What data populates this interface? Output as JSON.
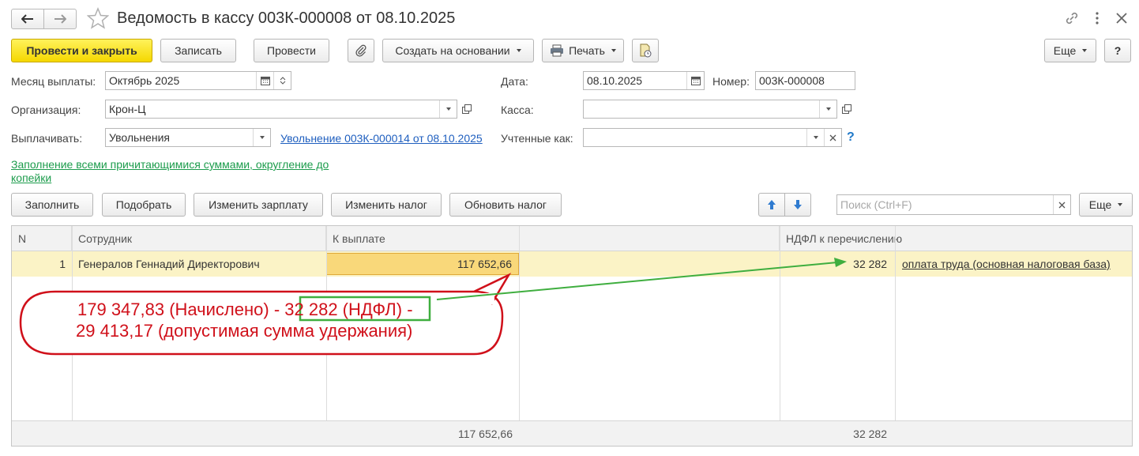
{
  "window": {
    "title": "Ведомость в кассу 003К-000008 от 08.10.2025"
  },
  "toolbar": {
    "post_close": "Провести и закрыть",
    "save": "Записать",
    "post": "Провести",
    "create_based": "Создать на основании",
    "print": "Печать",
    "more": "Еще",
    "help": "?"
  },
  "form": {
    "month_label": "Месяц выплаты:",
    "month_value": "Октябрь 2025",
    "date_label": "Дата:",
    "date_value": "08.10.2025",
    "number_label": "Номер:",
    "number_value": "003К-000008",
    "org_label": "Организация:",
    "org_value": "Крон-Ц",
    "cash_label": "Касса:",
    "cash_value": "",
    "pay_label": "Выплачивать:",
    "pay_value": "Увольнения",
    "pay_link": "Увольнение 003К-000014 от 08.10.2025",
    "accounted_label": "Учтенные как:",
    "accounted_value": "",
    "accounted_help": "?",
    "fill_link": "Заполнение всеми причитающимися суммами, округление до копейки"
  },
  "table_toolbar": {
    "fill": "Заполнить",
    "select": "Подобрать",
    "change_salary": "Изменить зарплату",
    "change_tax": "Изменить налог",
    "refresh_tax": "Обновить налог",
    "search_placeholder": "Поиск (Ctrl+F)",
    "more": "Еще"
  },
  "table": {
    "headers": [
      "N",
      "Сотрудник",
      "К выплате",
      "НДФЛ к перечислению"
    ],
    "rows": [
      {
        "n": "1",
        "employee": "Генералов Геннадий Директорович",
        "payout": "117 652,66",
        "ndfl": "32 282",
        "ndfl_type": "оплата труда (основная налоговая база)"
      }
    ],
    "footer": {
      "payout_total": "117 652,66",
      "ndfl_total": "32 282"
    }
  },
  "annotation": {
    "line1_a": "179 347,83 (Начислено) - ",
    "line1_b": "32 282 (НДФЛ)",
    "line1_c": " -",
    "line2": "29 413,17 (допустимая сумма удержания)",
    "callout_color": "#d0101a",
    "box_color": "#3fae3f"
  },
  "colors": {
    "primary_button": "#f5d800",
    "link": "#1f5fbf",
    "green_link": "#1c9c4c",
    "selected_row": "#fbf3c6",
    "selected_cell": "#f9d87a"
  }
}
